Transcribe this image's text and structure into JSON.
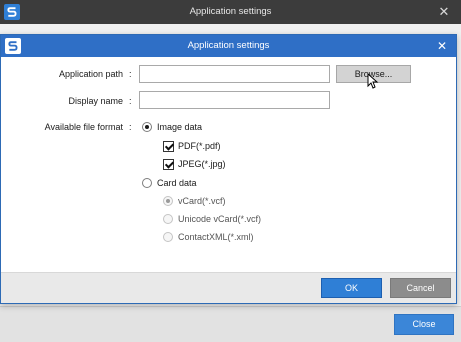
{
  "outer_window": {
    "title": "Application settings",
    "close_glyph": "✕",
    "close_button_label": "Close"
  },
  "dialog": {
    "title": "Application settings",
    "close_glyph": "✕",
    "application_path": {
      "label": "Application path",
      "colon": ":",
      "value": "",
      "browse_label": "Browse..."
    },
    "display_name": {
      "label": "Display name",
      "colon": ":",
      "value": ""
    },
    "file_format": {
      "label": "Available file format",
      "colon": ":",
      "image_data": {
        "label": "Image data",
        "selected": true,
        "options": [
          {
            "label": "PDF(*.pdf)",
            "checked": true
          },
          {
            "label": "JPEG(*.jpg)",
            "checked": true
          }
        ]
      },
      "card_data": {
        "label": "Card data",
        "selected": false,
        "options": [
          {
            "label": "vCard(*.vcf)",
            "selected": true,
            "disabled": true
          },
          {
            "label": "Unicode vCard(*.vcf)",
            "selected": false,
            "disabled": true
          },
          {
            "label": "ContactXML(*.xml)",
            "selected": false,
            "disabled": true
          }
        ]
      }
    },
    "ok_label": "OK",
    "cancel_label": "Cancel"
  },
  "icons": {
    "app_logo": "scansnap-logo-icon",
    "close": "close-icon",
    "cursor": "mouse-cursor-icon"
  },
  "colors": {
    "outer_titlebar": "#3c3c3c",
    "dialog_titlebar": "#2f6fc6",
    "ok_button": "#2f7fd6",
    "cancel_button": "#8c8c8c",
    "close_button": "#3b86d8"
  }
}
